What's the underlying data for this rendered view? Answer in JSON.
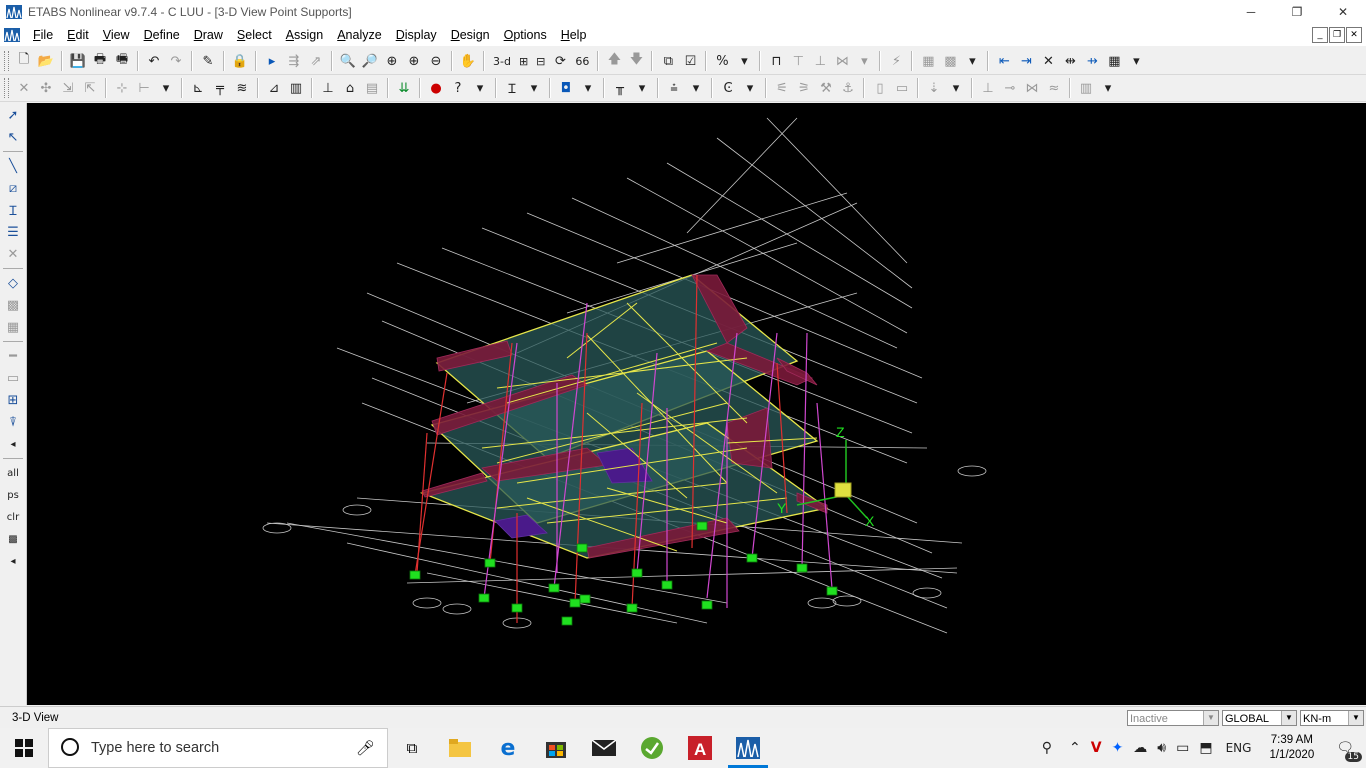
{
  "window": {
    "title": "ETABS Nonlinear v9.7.4 - C LUU - [3-D View  Point Supports]",
    "buttons": [
      "─",
      "❐",
      "✕"
    ]
  },
  "menu": [
    {
      "label": "File",
      "u": "F",
      "rest": "ile"
    },
    {
      "label": "Edit",
      "u": "E",
      "rest": "dit"
    },
    {
      "label": "View",
      "u": "V",
      "rest": "iew"
    },
    {
      "label": "Define",
      "u": "D",
      "rest": "efine"
    },
    {
      "label": "Draw",
      "u": "D",
      "rest": "raw"
    },
    {
      "label": "Select",
      "u": "S",
      "rest": "elect"
    },
    {
      "label": "Assign",
      "u": "A",
      "rest": "ssign"
    },
    {
      "label": "Analyze",
      "u": "A",
      "rest": "nalyze"
    },
    {
      "label": "Display",
      "u": "D",
      "rest": "isplay"
    },
    {
      "label": "Design",
      "u": "D",
      "rest": "esign"
    },
    {
      "label": "Options",
      "u": "O",
      "rest": "ptions"
    },
    {
      "label": "Help",
      "u": "H",
      "rest": "elp"
    }
  ],
  "mdi_buttons": [
    "_",
    "❐",
    "✕"
  ],
  "toolbar1": {
    "view_3d": "3-d",
    "view_plan": "Plan",
    "view_elev": "Elev",
    "rotate": "⟳",
    "perspective": "66"
  },
  "view_name": "3-D View",
  "status": {
    "inactive": "Inactive",
    "coord_system": "GLOBAL",
    "units": "KN-m"
  },
  "model": {
    "axis_labels": {
      "x": "X",
      "y": "Y",
      "z": "Z"
    },
    "colors": {
      "gridline": "#c8c8c8",
      "beam": "#e6e64a",
      "column_outer": "#e03030",
      "column_inner": "#d048d0",
      "slab_fill": "#2a5a5a",
      "wall": "#7a1a3a",
      "opening": "#4a1a8a",
      "support": "#20e020",
      "axis": "#20c020"
    }
  },
  "taskbar": {
    "search_placeholder": "Type here to search",
    "language": "ENG",
    "time": "7:39 AM",
    "date": "1/1/2020",
    "notifications": "15"
  }
}
